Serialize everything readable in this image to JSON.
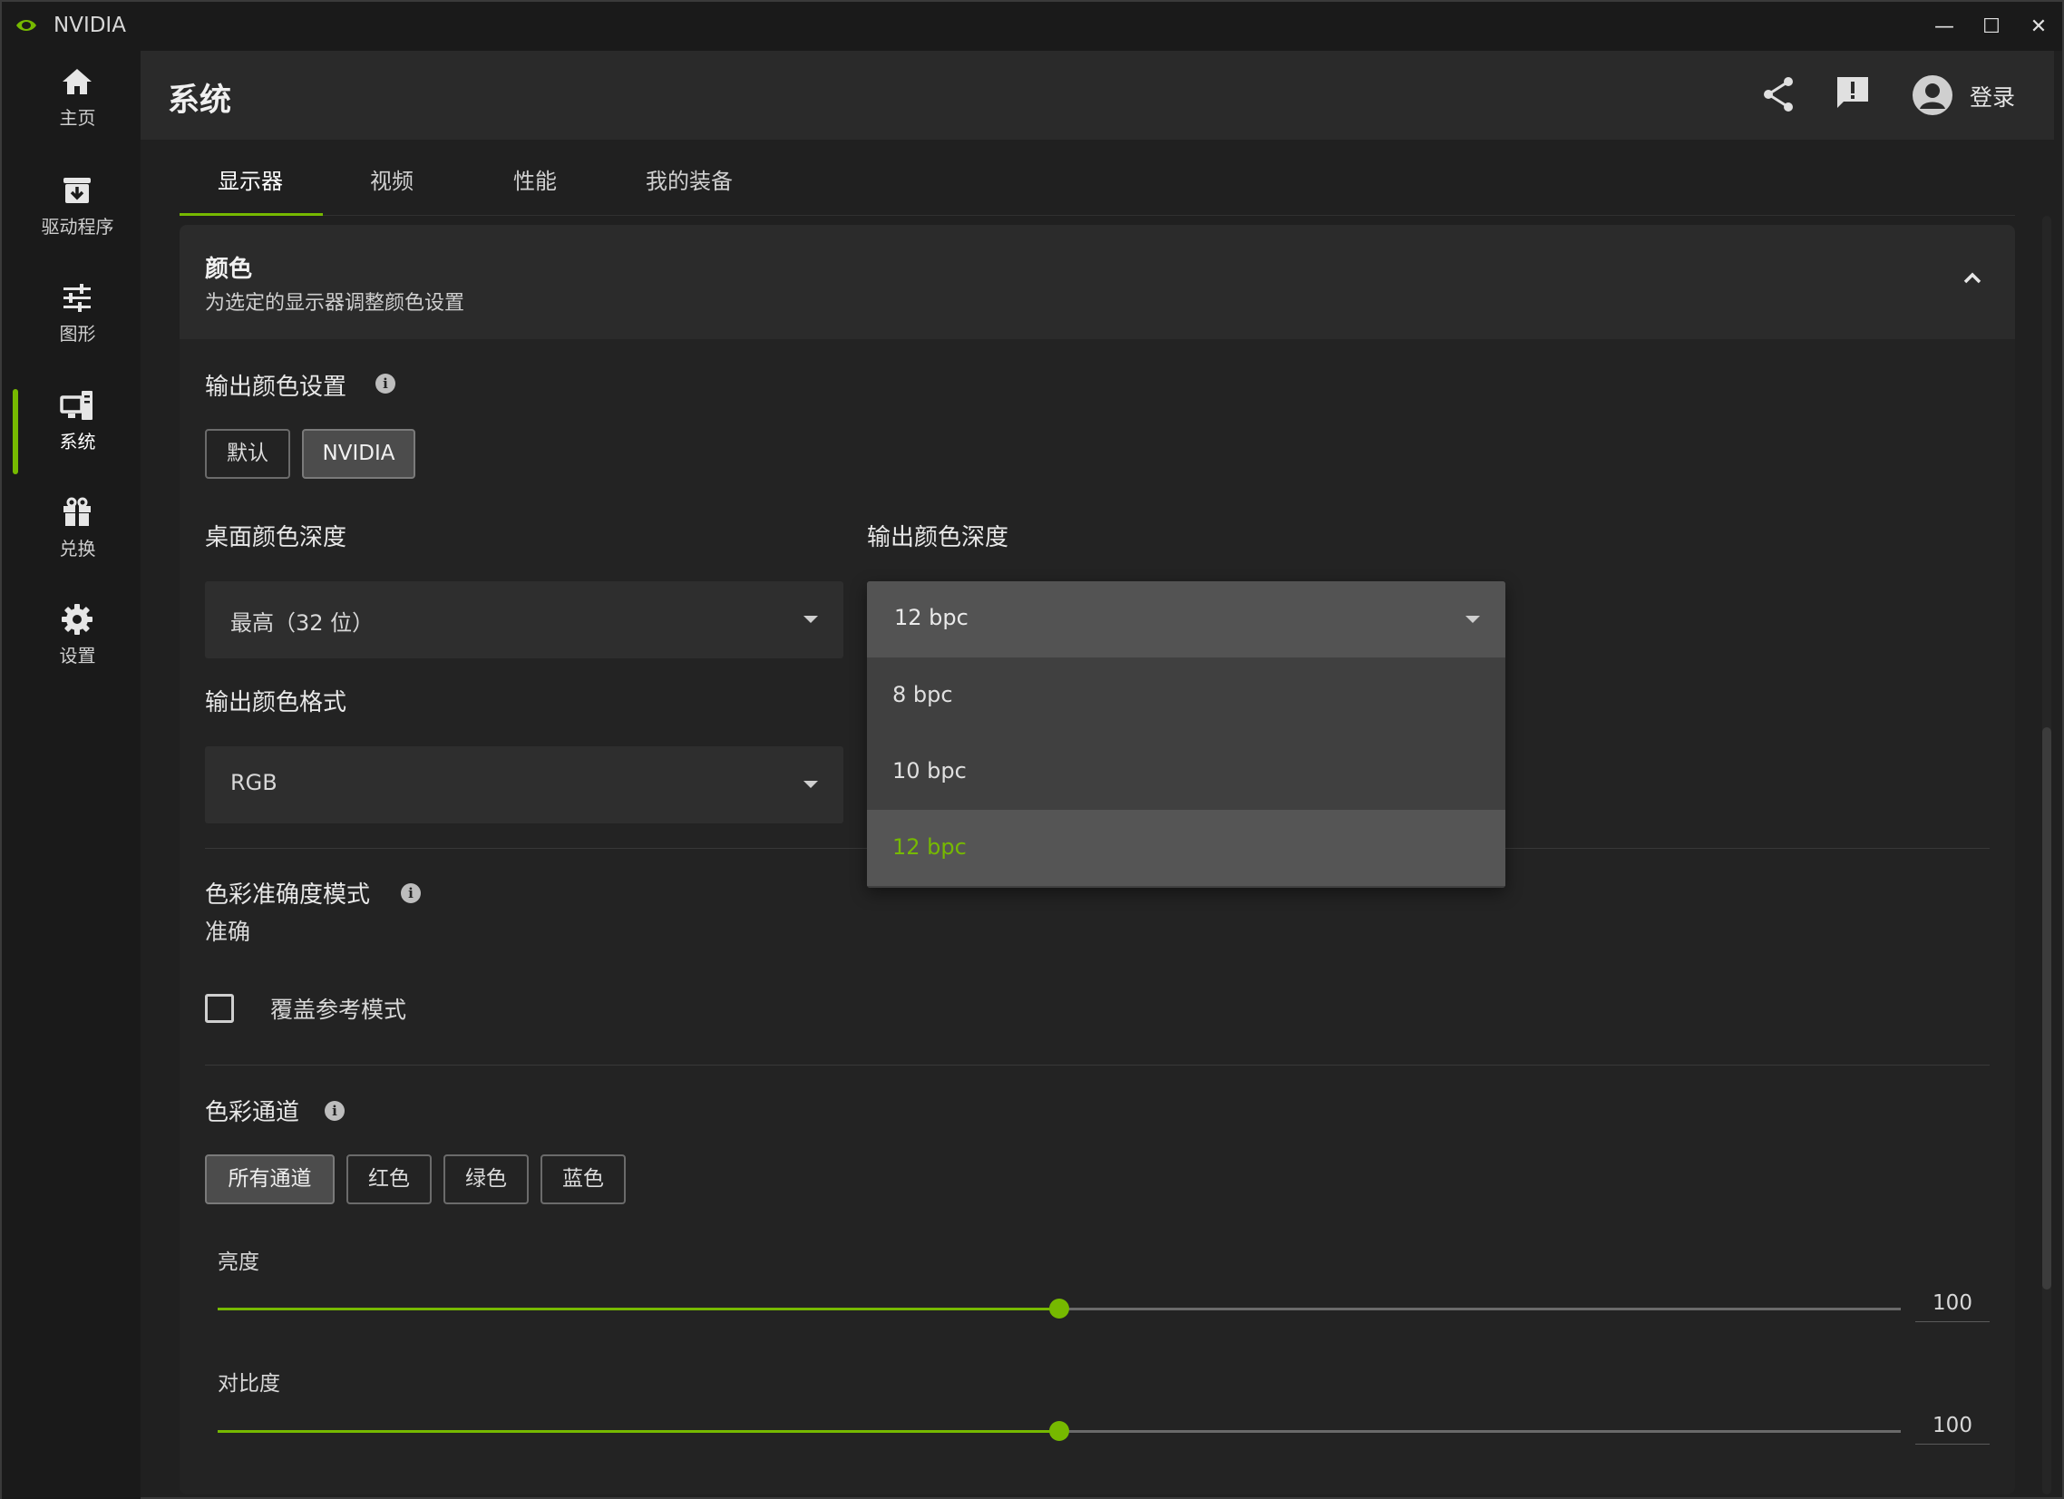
{
  "app": {
    "title": "NVIDIA",
    "brand_color": "#76b900"
  },
  "window_controls": {
    "minimize": "—",
    "maximize": "☐",
    "close": "✕"
  },
  "sidebar": {
    "items": [
      {
        "label": "主页",
        "icon": "home-icon"
      },
      {
        "label": "驱动程序",
        "icon": "driver-download-icon"
      },
      {
        "label": "图形",
        "icon": "sliders-icon"
      },
      {
        "label": "系统",
        "icon": "system-monitor-icon",
        "active": true
      },
      {
        "label": "兑换",
        "icon": "gift-icon"
      },
      {
        "label": "设置",
        "icon": "gear-icon"
      }
    ]
  },
  "header": {
    "title": "系统",
    "login_label": "登录"
  },
  "tabs": [
    {
      "label": "显示器",
      "active": true
    },
    {
      "label": "视频"
    },
    {
      "label": "性能"
    },
    {
      "label": "我的装备"
    }
  ],
  "panel": {
    "title": "颜色",
    "subtitle": "为选定的显示器调整颜色设置",
    "output_color_settings": {
      "label": "输出颜色设置",
      "options": [
        "默认",
        "NVIDIA"
      ],
      "selected": "NVIDIA"
    },
    "desktop_color_depth": {
      "label": "桌面颜色深度",
      "value": "最高（32 位）"
    },
    "output_color_depth": {
      "label": "输出颜色深度",
      "value": "12 bpc",
      "options": [
        "8 bpc",
        "10 bpc",
        "12 bpc"
      ],
      "open": true
    },
    "output_color_format": {
      "label": "输出颜色格式",
      "value": "RGB"
    },
    "color_accuracy": {
      "label": "色彩准确度模式",
      "value": "准确"
    },
    "override_reference": {
      "label": "覆盖参考模式",
      "checked": false
    },
    "color_channel": {
      "label": "色彩通道",
      "options": [
        "所有通道",
        "红色",
        "绿色",
        "蓝色"
      ],
      "selected": "所有通道"
    },
    "brightness": {
      "label": "亮度",
      "value": "100",
      "position_fraction": 0.5
    },
    "contrast": {
      "label": "对比度",
      "value": "100",
      "position_fraction": 0.5
    }
  }
}
